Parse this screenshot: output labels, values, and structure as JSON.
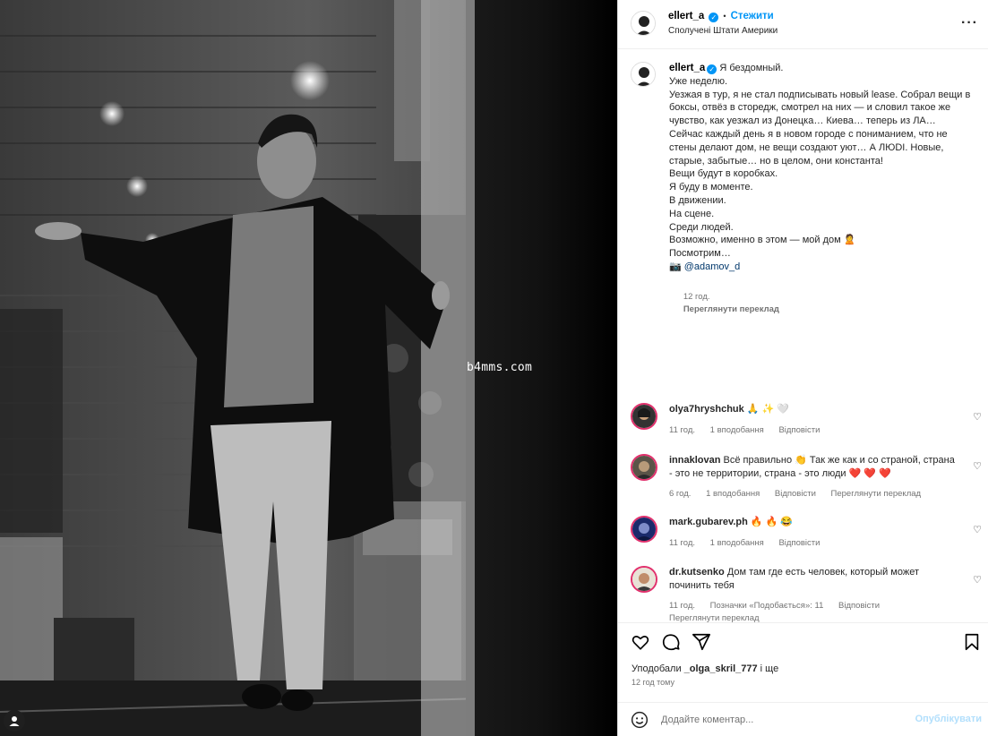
{
  "post": {
    "watermark": "b4mms.com"
  },
  "header": {
    "username": "ellert_a",
    "separator": "•",
    "follow_label": "Стежити",
    "location": "Сполучені Штати Америки",
    "more_icon": "more-horizontal-icon"
  },
  "caption": {
    "username": "ellert_a",
    "lines": [
      "Я бездомный.",
      "Уже неделю.",
      "",
      "Уезжая в тур, я не стал подписывать новый lease. Собрал вещи в боксы, отвёз в сторедж, смотрел на них — и словил такое же чувство, как уезжал из Донецка… Киева… теперь из ЛА…",
      "",
      "Сейчас каждый день я в новом городе с пониманием, что не стены делают дом, не вещи создают уют… А ЛЮDI. Новые, старые, забытые… но в целом, они константа!",
      "",
      "Вещи будут в коробках.",
      "Я буду в моменте.",
      "В движении.",
      "На сцене.",
      "Среди людей.",
      "",
      "Возможно, именно в этом — мой дом 🙎",
      "",
      "Посмотрим…",
      "",
      "📷 @adamov_d"
    ],
    "time": "12 год.",
    "translate": "Переглянути переклад"
  },
  "comments": [
    {
      "username": "olya7hryshchuk",
      "text": "🙏 ✨ 🤍",
      "time": "11 год.",
      "likes": "1 вподобання",
      "reply": "Відповісти",
      "translate": ""
    },
    {
      "username": "innaklovan",
      "text": "Всё правильно 👏 Так же как и со страной, страна - это не территории, страна - это люди ❤️ ❤️ ❤️",
      "time": "6 год.",
      "likes": "1 вподобання",
      "reply": "Відповісти",
      "translate": "Переглянути переклад"
    },
    {
      "username": "mark.gubarev.ph",
      "text": "🔥 🔥 😂",
      "time": "11 год.",
      "likes": "1 вподобання",
      "reply": "Відповісти",
      "translate": ""
    },
    {
      "username": "dr.kutsenko",
      "text": "Дом там где есть человек, который может починить тебя",
      "time": "11 год.",
      "likes": "Позначки «Подобається»: 11",
      "reply": "Відповісти",
      "translate": "Переглянути переклад"
    }
  ],
  "actions": {
    "like_icon": "heart-icon",
    "comment_icon": "comment-icon",
    "share_icon": "share-icon",
    "save_icon": "bookmark-icon"
  },
  "likes": {
    "prefix": "Уподобали",
    "user": "_olga_skril_777",
    "suffix": "і ще",
    "time_ago": "12 год тому"
  },
  "comment_box": {
    "placeholder": "Додайте коментар...",
    "publish_label": "Опублікувати"
  }
}
